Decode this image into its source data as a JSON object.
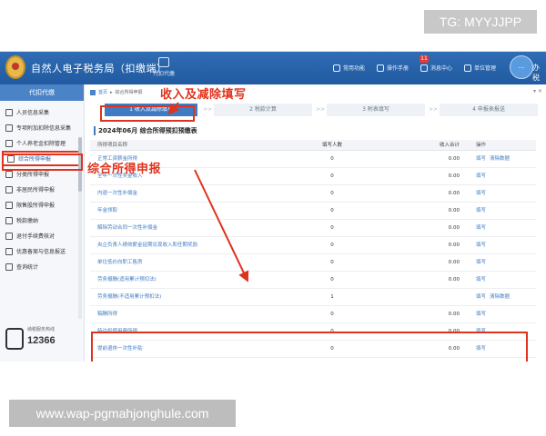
{
  "watermarks": {
    "top": "TG: MYYJJPP",
    "bottom": "www.wap-pgmahjonghule.com"
  },
  "app": {
    "title": "自然人电子税务局（扣缴端）",
    "top_nav": [
      {
        "label": "代扣代缴",
        "icon": "calendar-icon"
      }
    ],
    "top_right": [
      {
        "label": "常用功能",
        "icon": "star-icon"
      },
      {
        "label": "操作手册",
        "icon": "book-icon"
      },
      {
        "label": "消息中心",
        "icon": "mail-icon",
        "badge": "11"
      },
      {
        "label": "单位管理",
        "icon": "building-icon"
      }
    ],
    "avatar_label": "办税"
  },
  "sidebar": {
    "header": "代扣代缴",
    "items": [
      {
        "label": "人员信息采集",
        "icon": "person-icon"
      },
      {
        "label": "专项附加扣除信息采集",
        "icon": "clipboard-icon"
      },
      {
        "label": "个人养老金扣除管理",
        "icon": "card-icon"
      },
      {
        "label": "综合所得申报",
        "icon": "document-icon",
        "active": true
      },
      {
        "label": "分类所得申报",
        "icon": "folder-icon"
      },
      {
        "label": "非居民所得申报",
        "icon": "globe-icon"
      },
      {
        "label": "限售股所得申报",
        "icon": "chart-icon"
      },
      {
        "label": "税款缴纳",
        "icon": "wallet-icon"
      },
      {
        "label": "退付手续费核对",
        "icon": "receipt-icon"
      },
      {
        "label": "优惠备案与信息报送",
        "icon": "list-icon"
      },
      {
        "label": "查询统计",
        "icon": "search-icon"
      }
    ],
    "hotline": {
      "small_text": "纳税服务热线",
      "number": "12366"
    }
  },
  "main": {
    "breadcrumb": [
      "首页",
      "综合所得申报"
    ],
    "corner_controls": "▾ ✕",
    "steps": [
      {
        "label": "1 收入及减除填写",
        "active": true
      },
      {
        "label": "2 税款计算"
      },
      {
        "label": "3 附表填写"
      },
      {
        "label": "4 申报表报送"
      }
    ],
    "section_title": "2024年06月  综合所得预扣预缴表",
    "table": {
      "headers": [
        "所得项目名称",
        "填写人数",
        "收入合计",
        "操作"
      ],
      "rows": [
        {
          "name": "正常工资薪金所得",
          "count": "0",
          "income": "0.00",
          "ops": [
            "填写",
            "清除数据"
          ]
        },
        {
          "name": "全年一次性奖金收入",
          "count": "0",
          "income": "0.00",
          "ops": [
            "填写"
          ]
        },
        {
          "name": "内退一次性补偿金",
          "count": "0",
          "income": "0.00",
          "ops": [
            "填写"
          ]
        },
        {
          "name": "年金领取",
          "count": "0",
          "income": "0.00",
          "ops": [
            "填写"
          ]
        },
        {
          "name": "解除劳动合同一次性补偿金",
          "count": "0",
          "income": "0.00",
          "ops": [
            "填写"
          ]
        },
        {
          "name": "央企负责人绩效薪金延期兑现收入和任期奖励",
          "count": "0",
          "income": "0.00",
          "ops": [
            "填写"
          ]
        },
        {
          "name": "单位低价向职工售房",
          "count": "0",
          "income": "0.00",
          "ops": [
            "填写"
          ]
        },
        {
          "name": "劳务报酬(适用累计预扣法)",
          "count": "0",
          "income": "0.00",
          "ops": [
            "填写"
          ]
        },
        {
          "name": "劳务报酬(不适用累计预扣法)",
          "count": "1",
          "income": "",
          "ops": [
            "填写",
            "清除数据"
          ]
        },
        {
          "name": "稿酬所得",
          "count": "0",
          "income": "0.00",
          "ops": [
            "填写"
          ]
        },
        {
          "name": "特许权使用费所得",
          "count": "0",
          "income": "0.00",
          "ops": [
            "填写"
          ]
        },
        {
          "name": "提前退休一次性补贴",
          "count": "0",
          "income": "0.00",
          "ops": [
            "填写"
          ]
        }
      ]
    }
  },
  "annotations": {
    "callout_income": "收入及减除填写",
    "callout_comprehensive": "综合所得申报"
  },
  "colors": {
    "topbar": "#2f6db5",
    "accent": "#3f7cc4",
    "highlight": "#e0331d"
  }
}
